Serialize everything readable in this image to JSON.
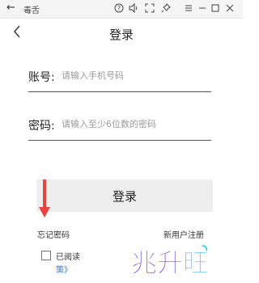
{
  "window": {
    "back_glyph": "←",
    "title": "毒舌",
    "controls": [
      "help-icon",
      "volume-icon",
      "fullscreen-icon",
      "pin-icon",
      "menu-icon",
      "minimize-icon",
      "maximize-icon",
      "close-icon"
    ]
  },
  "header": {
    "title": "登录"
  },
  "form": {
    "account": {
      "label": "账号:",
      "placeholder": "请输入手机号码",
      "value": ""
    },
    "password": {
      "label": "密码:",
      "placeholder": "请输入至少6位数的密码",
      "value": ""
    },
    "login_button": "登录"
  },
  "links": {
    "forgot_password": "忘记密码",
    "register": "新用户注册"
  },
  "agreement": {
    "checked": false,
    "label": "已阅读",
    "policy_link": "策》"
  },
  "watermark": {
    "text": "兆升旺"
  },
  "colors": {
    "accent_arrow": "#e8433f",
    "link_blue": "#2f7bd8",
    "button_bg": "#eeeeee"
  }
}
